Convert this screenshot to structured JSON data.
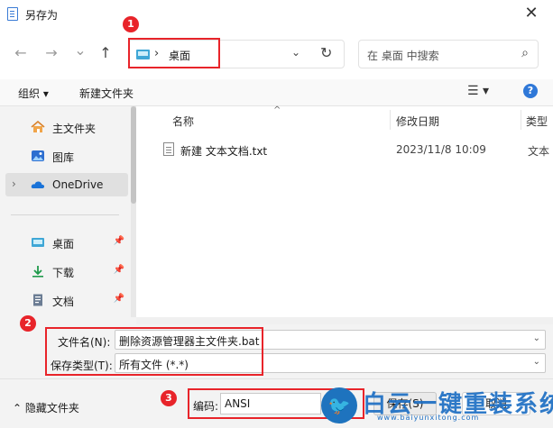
{
  "window": {
    "title": "另存为",
    "close_glyph": "✕"
  },
  "nav": {
    "back_glyph": "←",
    "forward_glyph": "→",
    "recent_glyph": "⌄",
    "up_glyph": "↑",
    "address": {
      "separator": "›",
      "location": "桌面",
      "dropdown_glyph": "⌄",
      "refresh_glyph": "↻"
    },
    "search_placeholder": "在 桌面 中搜索",
    "search_glyph": "⌕"
  },
  "toolbar": {
    "organize_label": "组织 ▾",
    "new_folder_label": "新建文件夹",
    "view_glyph": "☰ ▾",
    "help_glyph": "?"
  },
  "sidebar": {
    "items": [
      {
        "label": "主文件夹",
        "icon": "home-icon"
      },
      {
        "label": "图库",
        "icon": "gallery-icon"
      },
      {
        "label": "OneDrive",
        "icon": "cloud-icon",
        "expander": "›"
      },
      {
        "label": "桌面",
        "icon": "desktop-icon",
        "pin": "📌"
      },
      {
        "label": "下载",
        "icon": "download-icon",
        "pin": "📌"
      },
      {
        "label": "文档",
        "icon": "document-icon",
        "pin": "📌"
      }
    ]
  },
  "file_list": {
    "columns": [
      "名称",
      "修改日期",
      "类型"
    ],
    "sort_glyph": "^",
    "rows": [
      {
        "name": "新建 文本文档.txt",
        "modified": "2023/11/8 10:09",
        "type": "文本"
      }
    ]
  },
  "form": {
    "filename_label": "文件名(N):",
    "filename_value": "删除资源管理器主文件夹.bat",
    "filetype_label": "保存类型(T):",
    "filetype_value": "所有文件  (*.*)",
    "dropdown_glyph": "⌄"
  },
  "footer": {
    "hide_folders_label": "⌃  隐藏文件夹",
    "encoding_label": "编码:",
    "encoding_value": "ANSI",
    "save_label": "保存(S)",
    "cancel_label": "取消"
  },
  "annotations": {
    "badges": [
      "1",
      "2",
      "3"
    ],
    "color": "#e8242a"
  },
  "watermark": {
    "text": "白云一键重装系统",
    "url": "www.baiyunxitong.com",
    "bird_glyph": "🐦"
  }
}
